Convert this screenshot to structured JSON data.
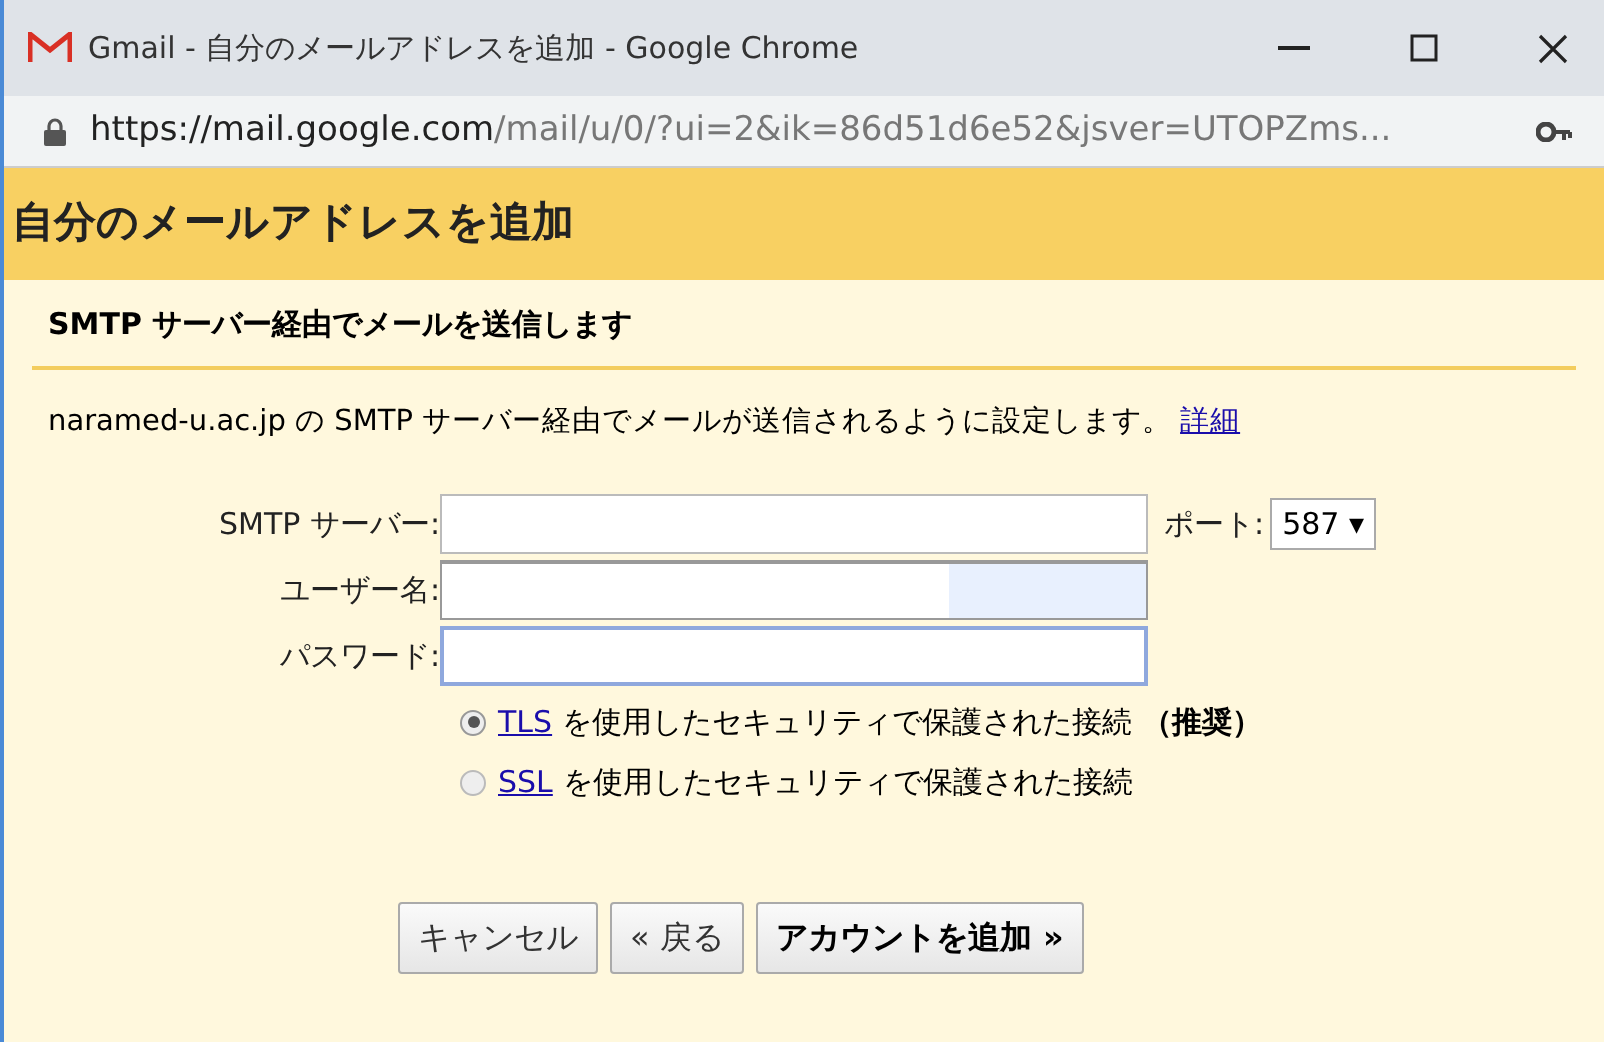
{
  "window": {
    "title": "Gmail - 自分のメールアドレスを追加 - Google Chrome"
  },
  "address_bar": {
    "host": "https://mail.google.com",
    "path": "/mail/u/0/?ui=2&ik=86d51d6e52&jsver=UTOPZms..."
  },
  "dialog": {
    "title": "自分のメールアドレスを追加",
    "section_title": "SMTP サーバー経由でメールを送信します",
    "description": "naramed-u.ac.jp の SMTP サーバー経由でメールが送信されるように設定します。",
    "details_link": "詳細"
  },
  "form": {
    "fields": [
      {
        "label": "SMTP サーバー:",
        "focused": false,
        "autofilled": false
      },
      {
        "label": "ユーザー名:",
        "focused": false,
        "autofilled": true
      },
      {
        "label": "パスワード:",
        "focused": true,
        "autofilled": false
      }
    ],
    "port": {
      "label": "ポート:",
      "value": "587 ▾"
    }
  },
  "security": [
    {
      "link": "TLS",
      "text": "を使用したセキュリティで保護された接続 **（推奨）**",
      "selected": true
    },
    {
      "link": "SSL",
      "text": "を使用したセキュリティで保護された接続",
      "selected": false
    }
  ],
  "buttons": [
    {
      "label": "キャンセル"
    },
    {
      "label": "« 戻る"
    },
    {
      "label": "アカウントを追加 »",
      "kind": "primary"
    }
  ]
}
